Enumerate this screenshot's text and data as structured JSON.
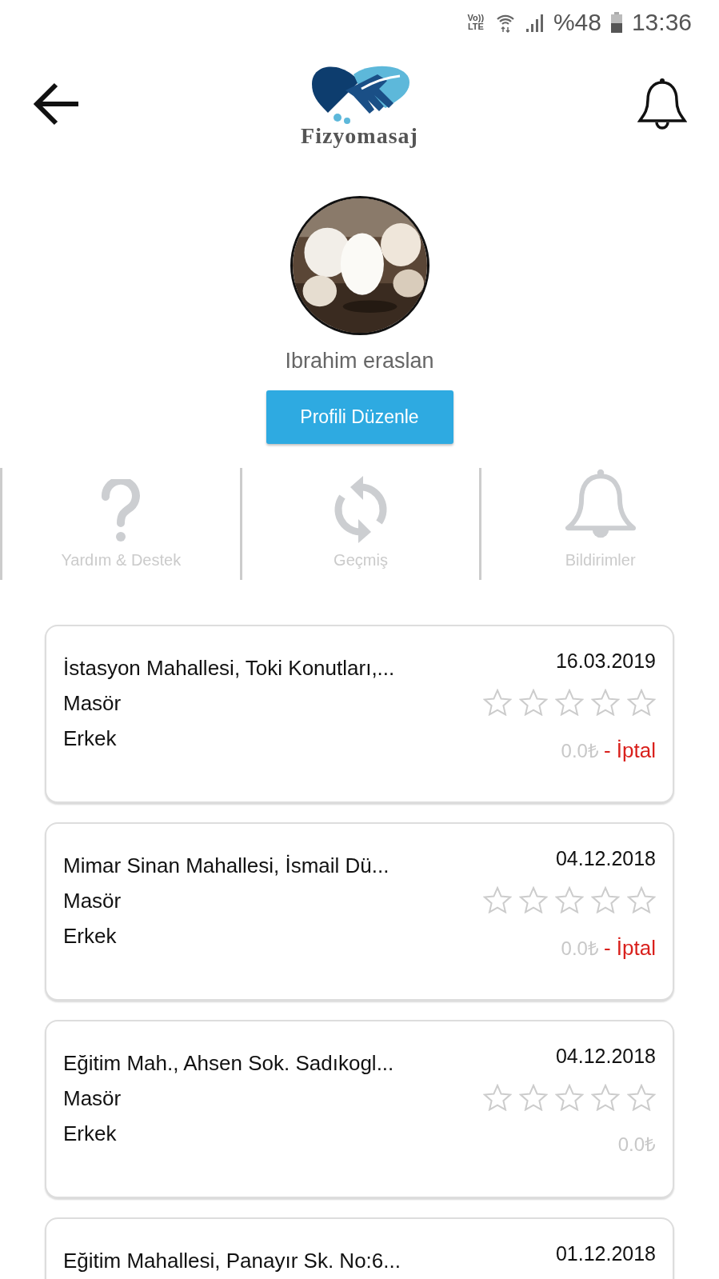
{
  "status_bar": {
    "network": "Vo)) LTE",
    "battery_percent": "%48",
    "time": "13:36"
  },
  "header": {
    "logo_text": "Fizyomasaj"
  },
  "profile": {
    "name": "Ibrahim eraslan",
    "edit_button": "Profili Düzenle"
  },
  "shortcuts": [
    {
      "kind": "help",
      "label": "Yardım & Destek"
    },
    {
      "kind": "history",
      "label": "Geçmiş"
    },
    {
      "kind": "notifications",
      "label": "Bildirimler"
    }
  ],
  "appointments": [
    {
      "address": "İstasyon Mahallesi, Toki Konutları,...",
      "date": "16.03.2019",
      "role": "Masör",
      "gender": "Erkek",
      "stars": 0,
      "price": "0.0₺",
      "status": "- İptal"
    },
    {
      "address": "Mimar Sinan Mahallesi, İsmail Dü...",
      "date": "04.12.2018",
      "role": "Masör",
      "gender": "Erkek",
      "stars": 0,
      "price": "0.0₺",
      "status": "- İptal"
    },
    {
      "address": "Eğitim Mah., Ahsen Sok. Sadıkogl...",
      "date": "04.12.2018",
      "role": "Masör",
      "gender": "Erkek",
      "stars": 0,
      "price": "0.0₺"
    },
    {
      "address": "Eğitim Mahallesi, Panayır Sk. No:6...",
      "date": "01.12.2018"
    }
  ]
}
